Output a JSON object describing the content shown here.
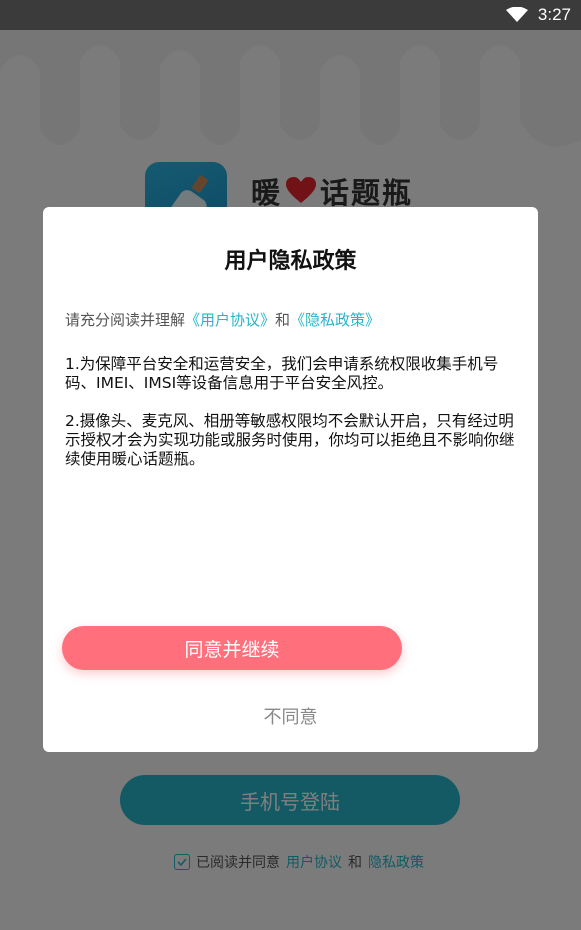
{
  "status_bar": {
    "time": "3:27"
  },
  "app": {
    "name_part1": "暖",
    "name_part2": "话题瓶",
    "login_button": "手机号登陆",
    "agree_prefix": "已阅读并同意",
    "user_agreement": "用户协议",
    "and": "和",
    "privacy_policy": "隐私政策"
  },
  "dialog": {
    "title": "用户隐私政策",
    "intro_prefix": "请充分阅读并理解",
    "intro_link1": "《用户协议》",
    "intro_and": "和",
    "intro_link2": "《隐私政策》",
    "para1": "1.为保障平台安全和运营安全，我们会申请系统权限收集手机号码、IMEI、IMSI等设备信息用于平台安全风控。",
    "para2": "2.摄像头、麦克风、相册等敏感权限均不会默认开启，只有经过明示授权才会为实现功能或服务时使用，你均可以拒绝且不影响你继续使用暖心话题瓶。",
    "agree_button": "同意并继续",
    "disagree_button": "不同意"
  },
  "colors": {
    "accent": "#27b4c9",
    "primary_button": "#ff6f7c",
    "heart": "#e0242d"
  }
}
